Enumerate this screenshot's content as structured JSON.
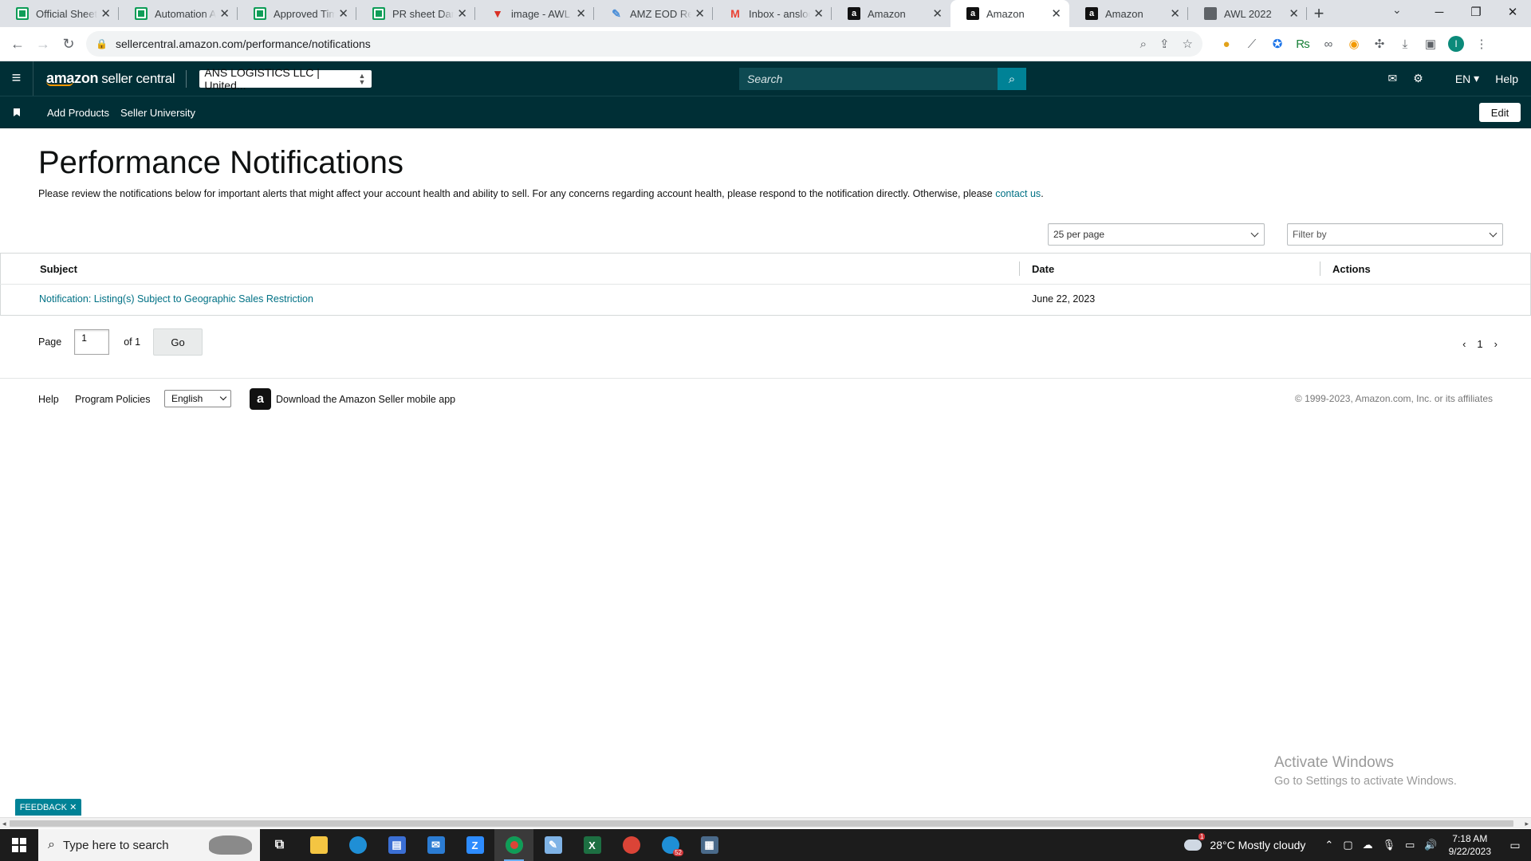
{
  "browser": {
    "tabs": [
      {
        "label": "Official Sheet Te",
        "favicon": "sheets-icon"
      },
      {
        "label": "Automation Anc",
        "favicon": "sheets-icon"
      },
      {
        "label": "Approved Time",
        "favicon": "sheets-icon"
      },
      {
        "label": "PR sheet Daniel",
        "favicon": "sheets-icon"
      },
      {
        "label": "image - AWL LA",
        "favicon": "v-logo-icon"
      },
      {
        "label": "AMZ EOD Repo",
        "favicon": "pen-icon"
      },
      {
        "label": "Inbox - anslogis",
        "favicon": "gmail-icon"
      },
      {
        "label": "Amazon",
        "favicon": "amazon-icon"
      },
      {
        "label": "Amazon",
        "favicon": "amazon-icon",
        "active": true
      },
      {
        "label": "Amazon",
        "favicon": "amazon-icon"
      },
      {
        "label": "AWL 2022",
        "favicon": "globe-icon"
      }
    ],
    "url": "sellercentral.amazon.com/performance/notifications",
    "profile_initial": "I"
  },
  "header": {
    "logo_bold": "amazon",
    "logo_rest": "seller central",
    "account": "ANS LOGISTICS LLC | United...",
    "search_placeholder": "Search",
    "language": "EN",
    "help": "Help"
  },
  "nav": {
    "items": [
      "Add Products",
      "Seller University"
    ],
    "edit": "Edit"
  },
  "main": {
    "title": "Performance Notifications",
    "intro": "Please review the notifications below for important alerts that might affect your account health and ability to sell. For any concerns regarding account health, please respond to the notification directly. Otherwise, please ",
    "intro_link": "contact us",
    "intro_end": ".",
    "per_page": "25 per page",
    "filter": "Filter by",
    "table": {
      "headers": {
        "subject": "Subject",
        "date": "Date",
        "actions": "Actions"
      },
      "rows": [
        {
          "subject": "Notification: Listing(s) Subject to Geographic Sales Restriction",
          "date": "June 22, 2023",
          "actions": ""
        }
      ]
    },
    "pager": {
      "label": "Page",
      "value": "1",
      "of": "of 1",
      "go": "Go",
      "current": "1"
    }
  },
  "footer": {
    "help": "Help",
    "policies": "Program Policies",
    "language": "English",
    "app_text": "Download the Amazon Seller mobile app",
    "copyright": "© 1999-2023, Amazon.com, Inc. or its affiliates"
  },
  "overlay": {
    "watermark_1": "Activate Windows",
    "watermark_2": "Go to Settings to activate Windows.",
    "feedback": "FEEDBACK"
  },
  "taskbar": {
    "search_placeholder": "Type here to search",
    "weather": "28°C  Mostly cloudy",
    "time": "7:18 AM",
    "date": "9/22/2023",
    "edge_badge": "52"
  },
  "colors": {
    "header_bg": "#002f36",
    "accent_teal": "#008296",
    "link": "#007185"
  }
}
